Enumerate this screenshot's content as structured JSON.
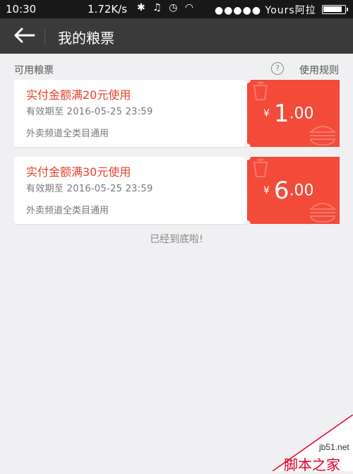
{
  "status_bar": {
    "time": "10:30",
    "network_speed": "1.72K/s",
    "carrier": "●●●●● Yours阿拉"
  },
  "title_bar": {
    "title": "我的粮票"
  },
  "section": {
    "label": "可用粮票",
    "rules_label": "使用规则",
    "help_glyph": "?"
  },
  "coupons": [
    {
      "condition": "实付金额满20元使用",
      "validity": "有效期至 2016-05-25 23:59",
      "scope": "外卖频道全类目通用",
      "currency": "¥",
      "amount_int": "1",
      "amount_dec": ".00"
    },
    {
      "condition": "实付金额满30元使用",
      "validity": "有效期至 2016-05-25 23:59",
      "scope": "外卖频道全类目通用",
      "currency": "¥",
      "amount_int": "6",
      "amount_dec": ".00"
    }
  ],
  "end_text": "已经到底啦!",
  "watermark": {
    "site": "jb51.net",
    "brand": "脚本之家"
  },
  "colors": {
    "coupon_red": "#f24b39",
    "condition_text": "#e8412b",
    "title_bar": "#3a3a3a",
    "status_bar": "#181818",
    "background": "#f0f0f2"
  }
}
